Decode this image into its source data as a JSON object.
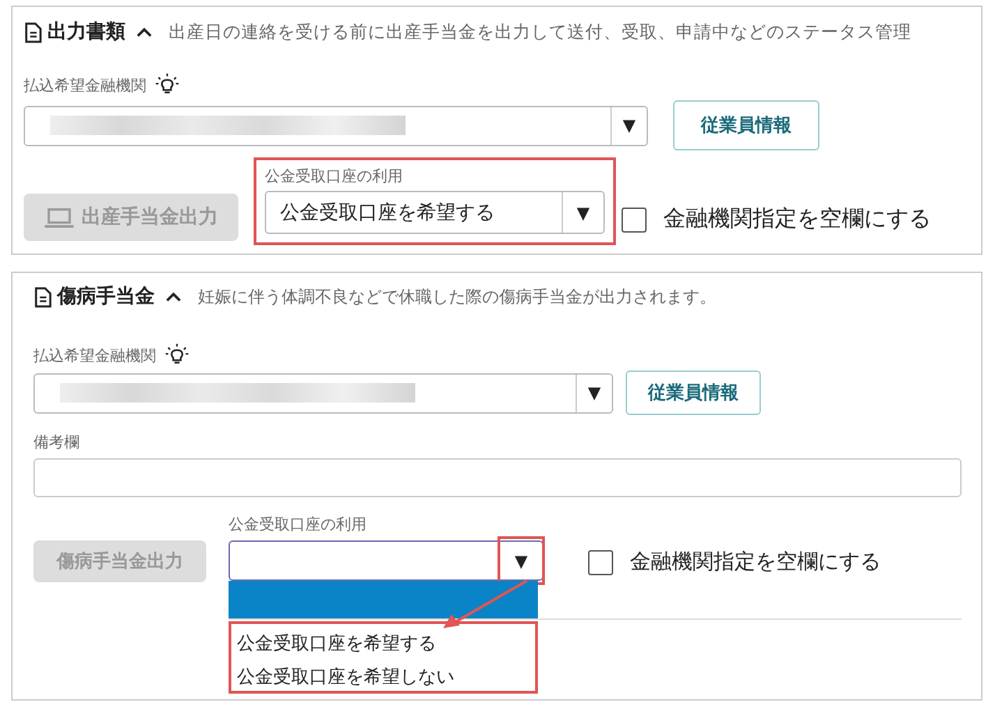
{
  "sections": [
    {
      "title": "出力書類",
      "expanded": true,
      "description": "出産日の連絡を受ける前に出産手当金を出力して送付、受取、申請中などのステータス管理",
      "bank_label": "払込希望金融機関",
      "bank_arrow": "▼",
      "employee_button": "従業員情報",
      "output_button": {
        "label": "出産手当金出力",
        "disabled": true
      },
      "account_label": "公金受取口座の利用",
      "account_select": {
        "value": "公金受取口座を希望する",
        "arrow": "▼",
        "arrow_highlighted": false
      },
      "account_highlighted": true,
      "checkbox": {
        "label": "金融機関指定を空欄にする",
        "checked": false
      }
    },
    {
      "title": "傷病手当金",
      "expanded": true,
      "description": "妊娠に伴う体調不良などで休職した際の傷病手当金が出力されます。",
      "bank_label": "払込希望金融機関",
      "bank_arrow": "▼",
      "employee_button": "従業員情報",
      "notes_label": "備考欄",
      "output_button": {
        "label": "傷病手当金出力",
        "disabled": true
      },
      "account_label": "公金受取口座の利用",
      "account_select": {
        "arrow": "▼",
        "open": true,
        "arrow_highlighted": true,
        "options_highlighted": true,
        "annotation_arrow": true,
        "options": [
          {
            "kind": "blank",
            "selected": true
          },
          {
            "kind": "text",
            "label": "公金受取口座を希望する",
            "selected": false
          },
          {
            "kind": "text",
            "label": "公金受取口座を希望しない",
            "selected": false
          }
        ]
      },
      "account_highlighted": false,
      "checkbox": {
        "label": "金融機関指定を空欄にする",
        "checked": false
      }
    }
  ]
}
